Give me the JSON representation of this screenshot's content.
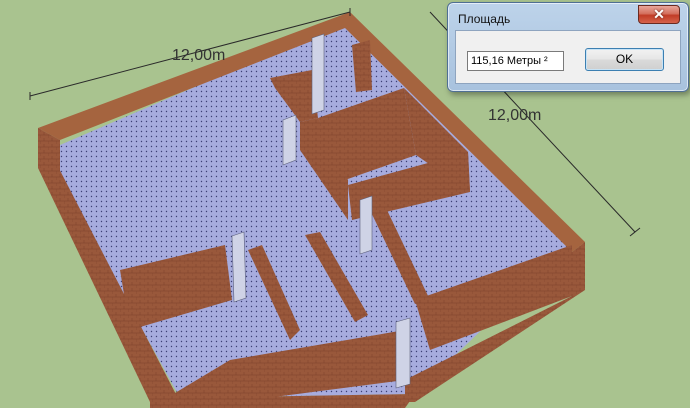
{
  "canvas": {
    "dimension_width": "12,00m",
    "dimension_depth": "12,00m",
    "colors": {
      "background": "#a9c38f",
      "wall_top": "#9a5b3c",
      "wall_side": "#8a4f33",
      "floor": "#a6acdb",
      "door": "#cfd3e6"
    }
  },
  "dialog": {
    "title": "Площадь",
    "close_icon": "close-icon",
    "area_value": "115,16 Метры ²",
    "ok_label": "OK"
  }
}
